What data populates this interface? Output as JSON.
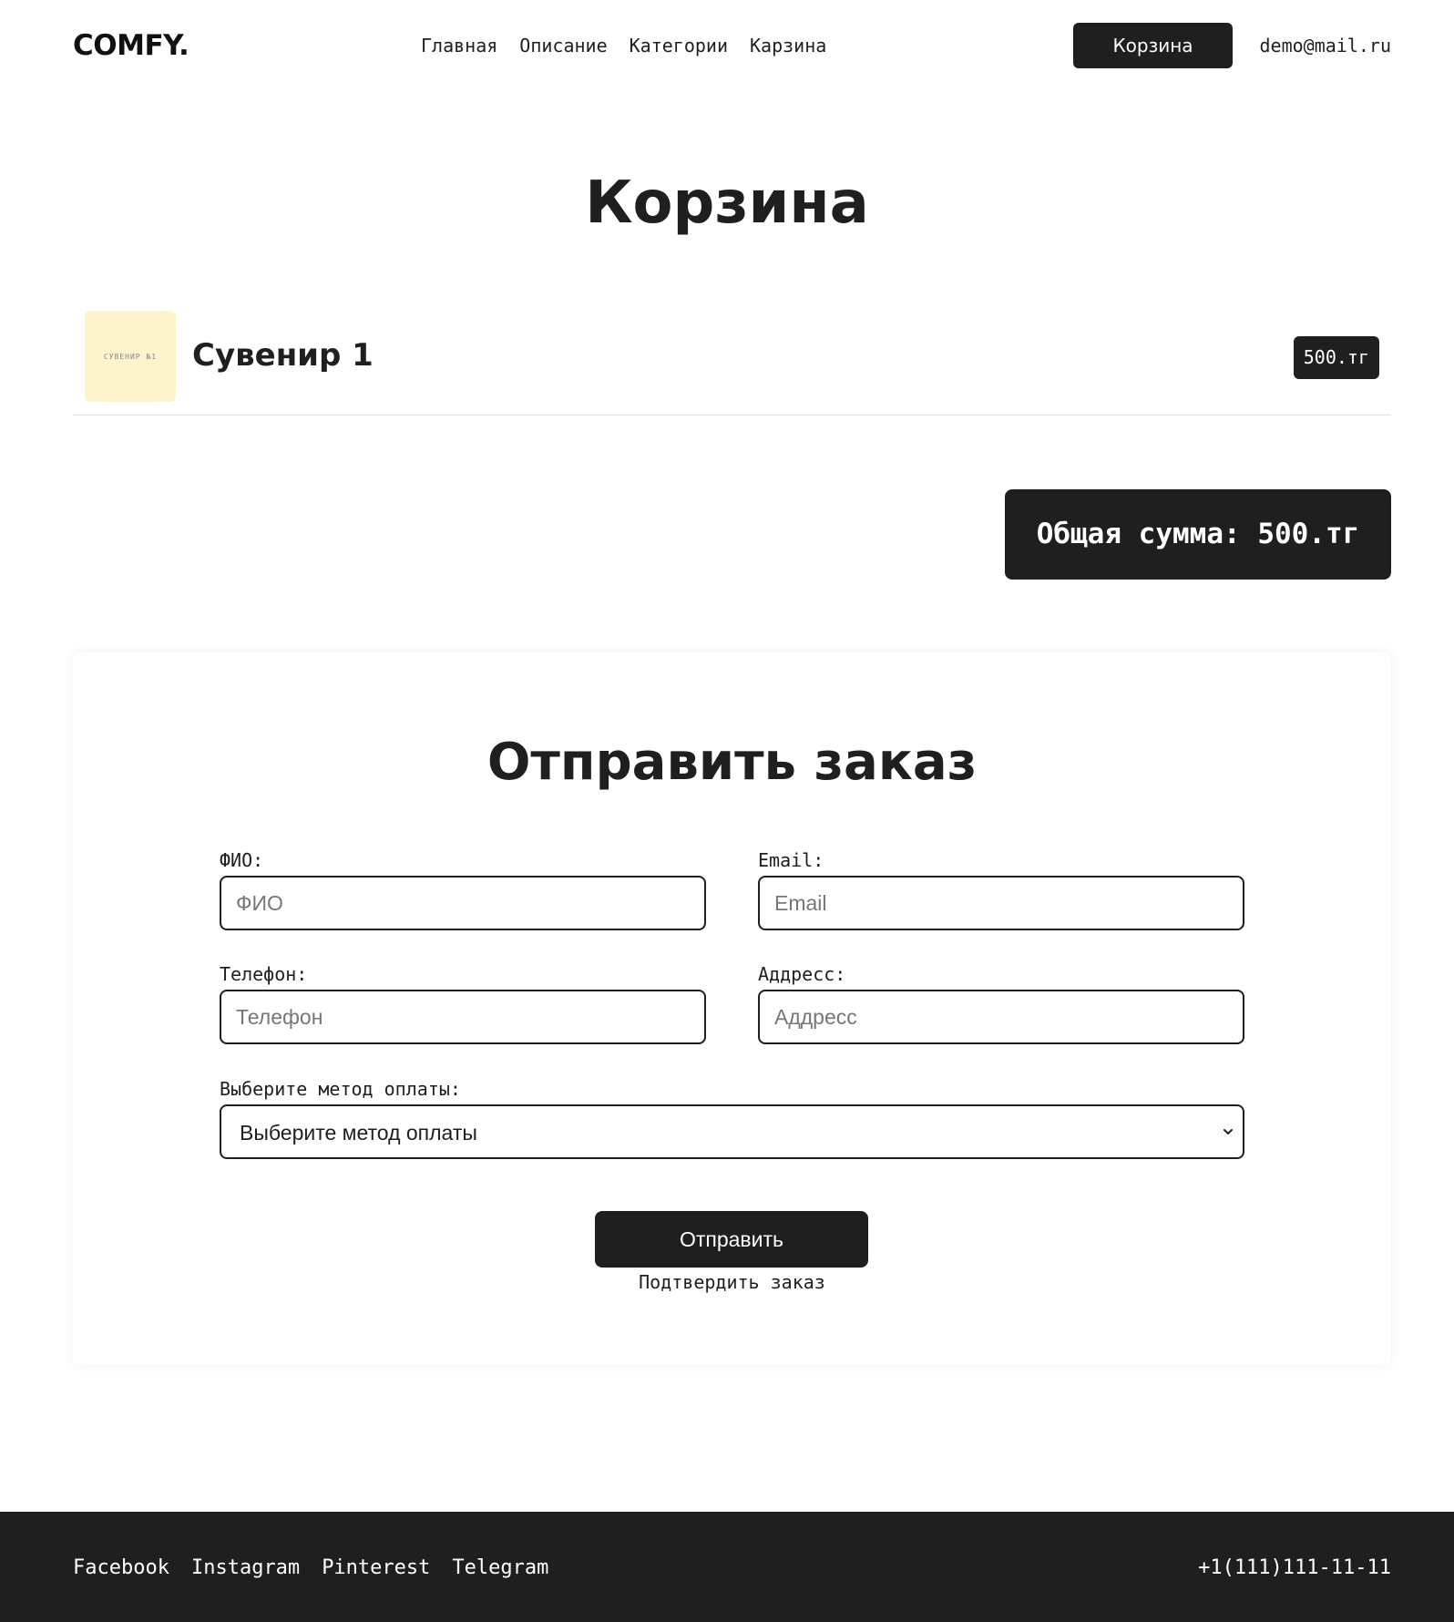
{
  "header": {
    "logo": "COMFY.",
    "nav": [
      "Главная",
      "Описание",
      "Категории",
      "Карзина"
    ],
    "cart_button": "Корзина",
    "user_email": "demo@mail.ru"
  },
  "page": {
    "title": "Корзина"
  },
  "cart": {
    "items": [
      {
        "thumb_text": "СУВЕНИР №1",
        "name": "Сувенир 1",
        "price": "500.тг"
      }
    ],
    "total": "Общая сумма: 500.тг"
  },
  "order_form": {
    "title": "Отправить заказ",
    "fields": {
      "fio": {
        "label": "ФИО:",
        "placeholder": "ФИО",
        "value": ""
      },
      "email": {
        "label": "Email:",
        "placeholder": "Email",
        "value": ""
      },
      "phone": {
        "label": "Телефон:",
        "placeholder": "Телефон",
        "value": ""
      },
      "address": {
        "label": "Аддресс:",
        "placeholder": "Аддресс",
        "value": ""
      }
    },
    "payment": {
      "label": "Выберите метод оплаты:",
      "selected": "Выберите метод оплаты"
    },
    "submit_label": "Отправить",
    "confirm_text": "Подтвердить заказ"
  },
  "footer": {
    "links": [
      "Facebook",
      "Instagram",
      "Pinterest",
      "Telegram"
    ],
    "phone": "+1(111)111-11-11"
  },
  "colors": {
    "dark": "#1f1f1f",
    "thumb_background": "#fdf3cd",
    "white": "#ffffff"
  }
}
